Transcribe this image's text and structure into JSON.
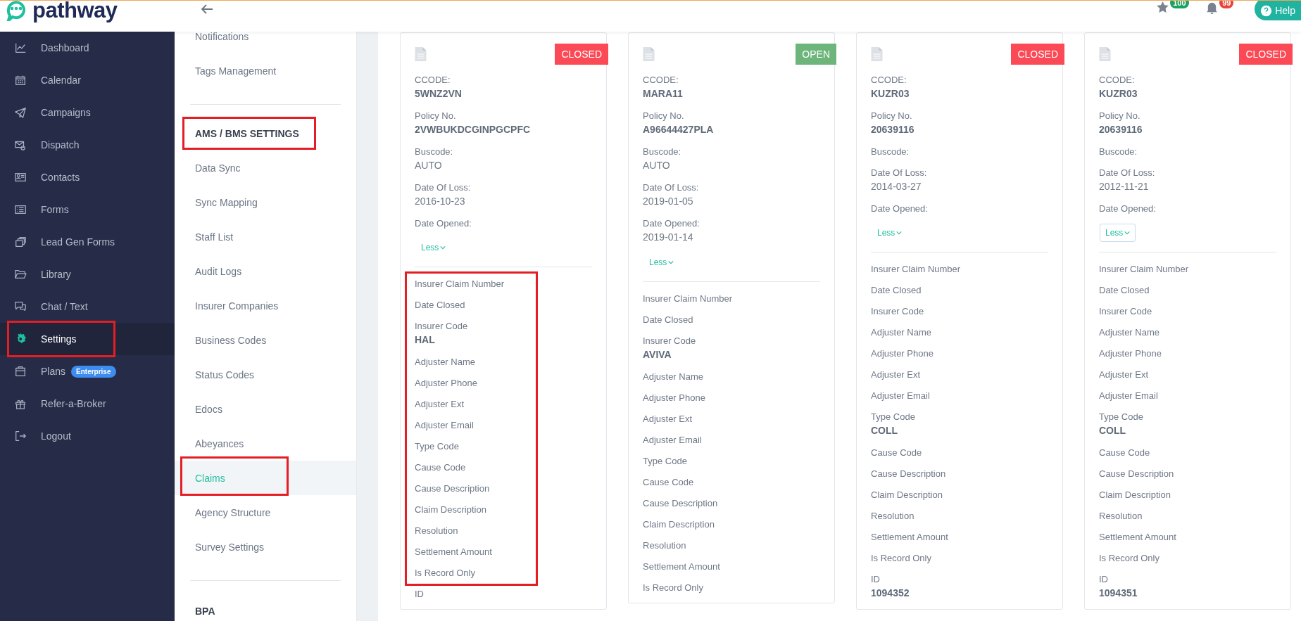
{
  "top_bar": {
    "logo_text": "pathway",
    "favorites_badge": "100",
    "notifications_badge": "99",
    "help_button": "Help"
  },
  "sidebar": {
    "items": [
      {
        "label": "Dashboard",
        "selected": false,
        "annotated": false
      },
      {
        "label": "Calendar",
        "selected": false,
        "annotated": false
      },
      {
        "label": "Campaigns",
        "selected": false,
        "annotated": false
      },
      {
        "label": "Dispatch",
        "selected": false,
        "annotated": false
      },
      {
        "label": "Contacts",
        "selected": false,
        "annotated": false
      },
      {
        "label": "Forms",
        "selected": false,
        "annotated": false
      },
      {
        "label": "Lead Gen Forms",
        "selected": false,
        "annotated": false
      },
      {
        "label": "Library",
        "selected": false,
        "annotated": false
      },
      {
        "label": "Chat / Text",
        "selected": false,
        "annotated": false
      },
      {
        "label": "Settings",
        "selected": true,
        "annotated": true
      },
      {
        "label": "Plans",
        "selected": false,
        "annotated": false,
        "badge": "Enterprise"
      },
      {
        "label": "Refer-a-Broker",
        "selected": false,
        "annotated": false
      },
      {
        "label": "Logout",
        "selected": false,
        "annotated": false
      }
    ]
  },
  "settings_menu": {
    "sections": [
      {
        "items": [
          {
            "label": "Notifications",
            "selected": false,
            "annotated": false
          },
          {
            "label": "Tags Management",
            "selected": false,
            "annotated": false
          }
        ]
      },
      {
        "heading": {
          "text": "AMS / BMS SETTINGS",
          "annotated": true
        },
        "items": [
          {
            "label": "Data Sync",
            "selected": false,
            "annotated": false
          },
          {
            "label": "Sync Mapping",
            "selected": false,
            "annotated": false
          },
          {
            "label": "Staff List",
            "selected": false,
            "annotated": false
          },
          {
            "label": "Audit Logs",
            "selected": false,
            "annotated": false
          },
          {
            "label": "Insurer Companies",
            "selected": false,
            "annotated": false
          },
          {
            "label": "Business Codes",
            "selected": false,
            "annotated": false
          },
          {
            "label": "Status Codes",
            "selected": false,
            "annotated": false
          },
          {
            "label": "Edocs",
            "selected": false,
            "annotated": false
          },
          {
            "label": "Abeyances",
            "selected": false,
            "annotated": false
          },
          {
            "label": "Claims",
            "selected": true,
            "annotated": true
          },
          {
            "label": "Agency Structure",
            "selected": false,
            "annotated": false
          },
          {
            "label": "Survey Settings",
            "selected": false,
            "annotated": false
          }
        ]
      },
      {
        "heading": {
          "text": "BPA"
        }
      }
    ]
  },
  "cards": [
    {
      "status": "CLOSED",
      "color": "#fb4a55",
      "summary_fields": [
        {
          "label": "CCODE:",
          "value": "5WNZ2VN",
          "bold": true
        },
        {
          "label": "Policy No.",
          "value": "2VWBUKDCGINPGCPFC",
          "bold": true
        },
        {
          "label": "Buscode:",
          "value": "AUTO",
          "bold": false
        },
        {
          "label": "Date Of Loss:",
          "value": "2016-10-23",
          "bold": false
        },
        {
          "label": "Date Opened:"
        }
      ],
      "less_button": {
        "label": "Less",
        "focused": false
      },
      "details_annotated": true,
      "detail_fields": [
        {
          "label": "Insurer Claim Number"
        },
        {
          "label": "Date Closed"
        },
        {
          "label": "Insurer Code",
          "value": "HAL",
          "bold": true
        },
        {
          "label": "Adjuster Name"
        },
        {
          "label": "Adjuster Phone"
        },
        {
          "label": "Adjuster Ext"
        },
        {
          "label": "Adjuster Email"
        },
        {
          "label": "Type Code"
        },
        {
          "label": "Cause Code"
        },
        {
          "label": "Cause Description"
        },
        {
          "label": "Claim Description"
        },
        {
          "label": "Resolution"
        },
        {
          "label": "Settlement Amount"
        },
        {
          "label": "Is Record Only"
        }
      ],
      "id_field": {
        "label": "ID"
      }
    },
    {
      "status": "OPEN",
      "color": "#6db57b",
      "summary_fields": [
        {
          "label": "CCODE:",
          "value": "MARA11",
          "bold": true
        },
        {
          "label": "Policy No.",
          "value": "A96644427PLA",
          "bold": true
        },
        {
          "label": "Buscode:",
          "value": "AUTO",
          "bold": false
        },
        {
          "label": "Date Of Loss:",
          "value": "2019-01-05",
          "bold": false
        },
        {
          "label": "Date Opened:",
          "value": "2019-01-14",
          "bold": false
        }
      ],
      "less_button": {
        "label": "Less",
        "focused": false
      },
      "details_annotated": false,
      "detail_fields": [
        {
          "label": "Insurer Claim Number"
        },
        {
          "label": "Date Closed"
        },
        {
          "label": "Insurer Code",
          "value": "AVIVA",
          "bold": true
        },
        {
          "label": "Adjuster Name"
        },
        {
          "label": "Adjuster Phone"
        },
        {
          "label": "Adjuster Ext"
        },
        {
          "label": "Adjuster Email"
        },
        {
          "label": "Type Code"
        },
        {
          "label": "Cause Code"
        },
        {
          "label": "Cause Description"
        },
        {
          "label": "Claim Description"
        },
        {
          "label": "Resolution"
        },
        {
          "label": "Settlement Amount"
        },
        {
          "label": "Is Record Only"
        }
      ]
    },
    {
      "status": "CLOSED",
      "color": "#fb4a55",
      "summary_fields": [
        {
          "label": "CCODE:",
          "value": "KUZR03",
          "bold": true
        },
        {
          "label": "Policy No.",
          "value": "20639116",
          "bold": true
        },
        {
          "label": "Buscode:"
        },
        {
          "label": "Date Of Loss:",
          "value": "2014-03-27",
          "bold": false
        },
        {
          "label": "Date Opened:"
        }
      ],
      "less_button": {
        "label": "Less",
        "focused": false
      },
      "details_annotated": false,
      "detail_fields": [
        {
          "label": "Insurer Claim Number"
        },
        {
          "label": "Date Closed"
        },
        {
          "label": "Insurer Code"
        },
        {
          "label": "Adjuster Name"
        },
        {
          "label": "Adjuster Phone"
        },
        {
          "label": "Adjuster Ext"
        },
        {
          "label": "Adjuster Email"
        },
        {
          "label": "Type Code",
          "value": "COLL",
          "bold": true
        },
        {
          "label": "Cause Code"
        },
        {
          "label": "Cause Description"
        },
        {
          "label": "Claim Description"
        },
        {
          "label": "Resolution"
        },
        {
          "label": "Settlement Amount"
        },
        {
          "label": "Is Record Only"
        }
      ],
      "id_field": {
        "label": "ID",
        "value": "1094352",
        "bold": true
      }
    },
    {
      "status": "CLOSED",
      "color": "#fb4a55",
      "summary_fields": [
        {
          "label": "CCODE:",
          "value": "KUZR03",
          "bold": true
        },
        {
          "label": "Policy No.",
          "value": "20639116",
          "bold": true
        },
        {
          "label": "Buscode:"
        },
        {
          "label": "Date Of Loss:",
          "value": "2012-11-21",
          "bold": false
        },
        {
          "label": "Date Opened:"
        }
      ],
      "less_button": {
        "label": "Less",
        "focused": true
      },
      "details_annotated": false,
      "detail_fields": [
        {
          "label": "Insurer Claim Number"
        },
        {
          "label": "Date Closed"
        },
        {
          "label": "Insurer Code"
        },
        {
          "label": "Adjuster Name"
        },
        {
          "label": "Adjuster Phone"
        },
        {
          "label": "Adjuster Ext"
        },
        {
          "label": "Adjuster Email"
        },
        {
          "label": "Type Code",
          "value": "COLL",
          "bold": true
        },
        {
          "label": "Cause Code"
        },
        {
          "label": "Cause Description"
        },
        {
          "label": "Claim Description"
        },
        {
          "label": "Resolution"
        },
        {
          "label": "Settlement Amount"
        },
        {
          "label": "Is Record Only"
        }
      ],
      "id_field": {
        "label": "ID",
        "value": "1094351",
        "bold": true
      }
    }
  ]
}
